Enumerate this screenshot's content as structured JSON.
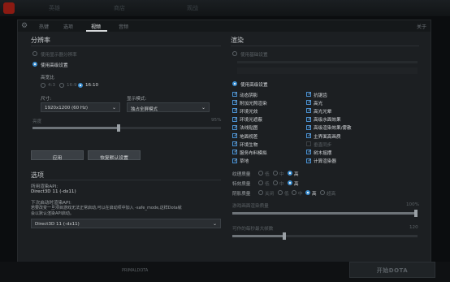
{
  "top_bar": {
    "ghost_items": [
      "英雄",
      "商店",
      "观战"
    ]
  },
  "tabs": {
    "items": [
      "热键",
      "选项",
      "视频",
      "音频"
    ],
    "active": "视频",
    "close": "关于"
  },
  "resolution": {
    "heading": "分辨率",
    "use_display_label": "使用显示器分辨率",
    "use_advanced_label": "使用高级设置",
    "aspect_label": "高宽比",
    "aspect_options": [
      "4:3",
      "16:9",
      "16:10"
    ],
    "aspect_selected": "16:10",
    "size_label": "尺寸:",
    "size_value": "1920x1200 (60 Hz)",
    "display_mode_label": "显示模式:",
    "display_mode_value": "独占全屏模式",
    "brightness_label": "亮度",
    "brightness_value_text": "95%",
    "brightness_fraction": 0.45,
    "apply_label": "应用",
    "restore_label": "恢复默认设置"
  },
  "options": {
    "heading": "选项",
    "api_label": "所用渲染API:",
    "api_value": "Direct3D 11 (-dx11)",
    "next_api_label": "下次启动时渲染API:",
    "note_line1": "若要改变一旦项目游戏无法正常启动,可以在启动项中加入 -safe_mode,这样Dota就",
    "note_line2": "会以默认渲染API启动。",
    "next_api_value": "Direct3D 11 (-dx11)"
  },
  "rendering": {
    "heading": "渲染",
    "use_basic_label": "使用基础设置",
    "use_advanced_label": "使用高级设置",
    "checkboxes_left": [
      {
        "label": "动态阴影",
        "checked": true
      },
      {
        "label": "附加光照渲染",
        "checked": true
      },
      {
        "label": "环境光效",
        "checked": true
      },
      {
        "label": "环境光遮蔽",
        "checked": true
      },
      {
        "label": "法线贴图",
        "checked": true
      },
      {
        "label": "地面视差",
        "checked": true
      },
      {
        "label": "环境生物",
        "checked": true
      },
      {
        "label": "服务布料模拟",
        "checked": true
      },
      {
        "label": "草地",
        "checked": true
      }
    ],
    "checkboxes_right": [
      {
        "label": "抗锯齿",
        "checked": true
      },
      {
        "label": "高光",
        "checked": true
      },
      {
        "label": "高光光晕",
        "checked": true
      },
      {
        "label": "高级水面效果",
        "checked": true
      },
      {
        "label": "高级渲染效果/雾散",
        "checked": true
      },
      {
        "label": "主界面高画质",
        "checked": true
      },
      {
        "label": "垂直同步",
        "checked": false
      },
      {
        "label": "树木摇摆",
        "checked": true
      },
      {
        "label": "计算渲染器",
        "checked": true
      }
    ],
    "texture_label": "纹理质量",
    "effects_label": "特效质量",
    "shadow_label": "阴影质量",
    "quality_low": "低",
    "quality_mid": "中",
    "quality_high": "高",
    "quality_off": "关闭",
    "quality_ultra": "超高",
    "render_quality_label": "游戏画面渲染质量",
    "render_quality_text": "100%",
    "render_quality_fraction": 1.0,
    "fps_label": "可作的每秒最大帧数",
    "fps_text": "120",
    "fps_fraction": 0.27
  },
  "bottom": {
    "play_label": "开始DOTA",
    "left_text": "PRIMALDOTA"
  }
}
